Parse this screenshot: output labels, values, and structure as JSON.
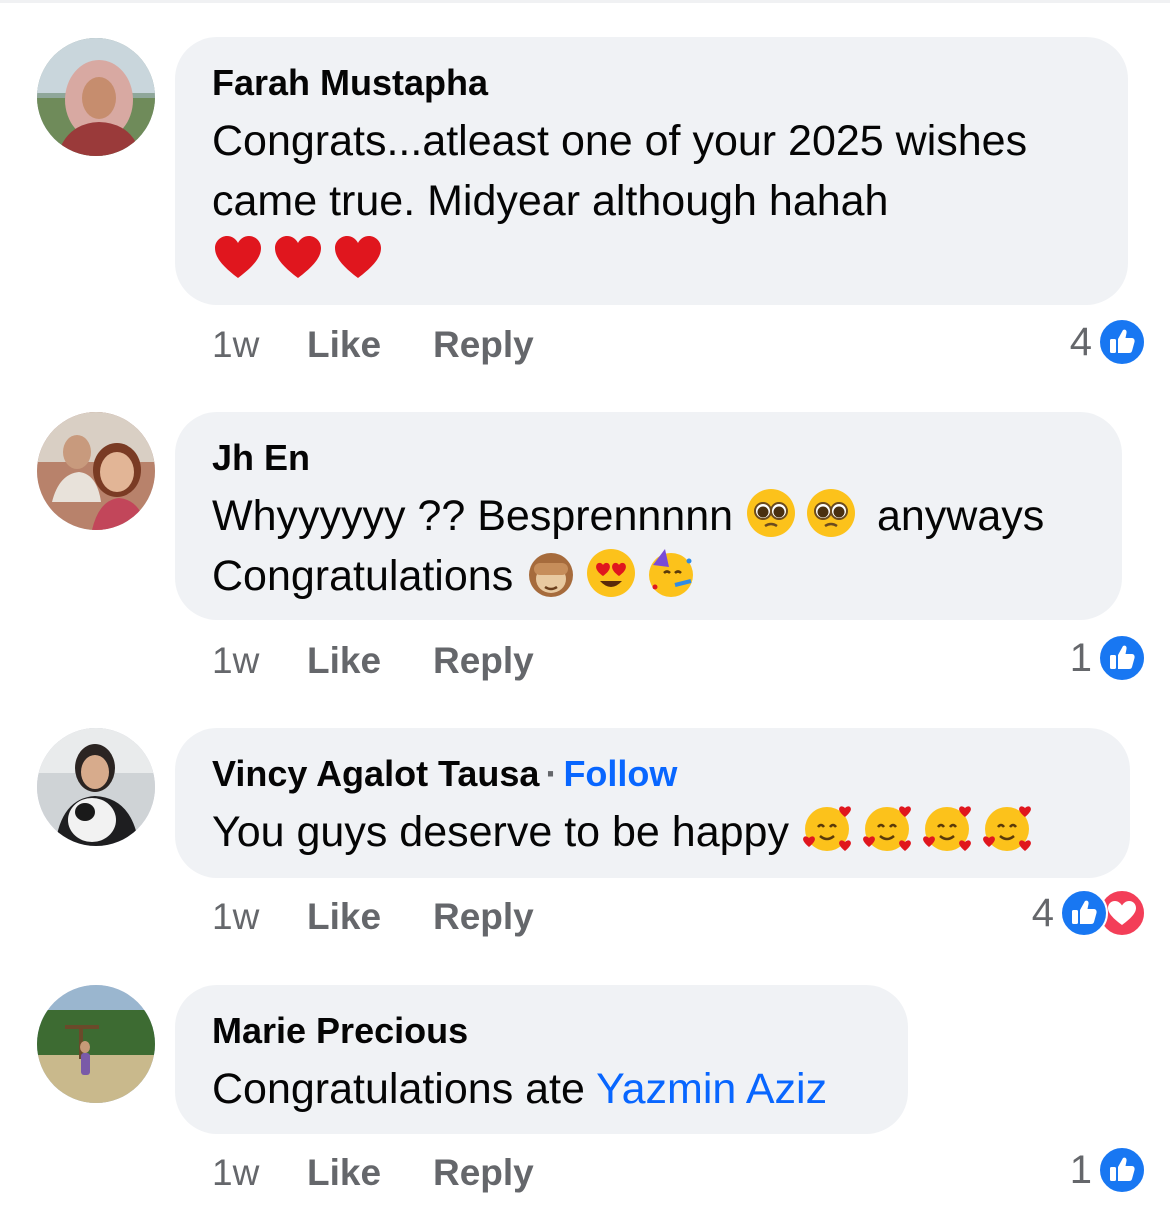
{
  "comments": [
    {
      "author": "Farah Mustapha",
      "follow": null,
      "text_line1": "Congrats...atleast one of your 2025 wishes",
      "text_line2": "came true. Midyear although hahah",
      "emojis_line3": [
        "red-heart",
        "red-heart",
        "red-heart"
      ],
      "time": "1w",
      "like": "Like",
      "reply": "Reply",
      "reaction_count": "4",
      "reactions": [
        "like"
      ]
    },
    {
      "author": "Jh En",
      "follow": null,
      "text_line1_a": "Whyyyyyy ?? Besprennnnn",
      "text_line1_emojis": [
        "pleading-face",
        "pleading-face"
      ],
      "text_line1_b": "anyways",
      "text_line2": "Congratulations",
      "text_line2_emojis": [
        "see-no-evil-monkey",
        "heart-eyes",
        "partying-face"
      ],
      "time": "1w",
      "like": "Like",
      "reply": "Reply",
      "reaction_count": "1",
      "reactions": [
        "like"
      ]
    },
    {
      "author": "Vincy Agalot Tausa",
      "separator": "·",
      "follow": "Follow",
      "text_line1": "You guys deserve to be happy",
      "text_line1_emojis": [
        "smiling-face-with-hearts",
        "smiling-face-with-hearts",
        "smiling-face-with-hearts",
        "smiling-face-with-hearts"
      ],
      "time": "1w",
      "like": "Like",
      "reply": "Reply",
      "reaction_count": "4",
      "reactions": [
        "like",
        "love"
      ]
    },
    {
      "author": "Marie Precious",
      "follow": null,
      "text_line1": "Congratulations ate",
      "mention": "Yazmin Aziz",
      "time": "1w",
      "like": "Like",
      "reply": "Reply",
      "reaction_count": "1",
      "reactions": [
        "like"
      ]
    }
  ],
  "colors": {
    "bubble": "#f0f2f5",
    "link": "#0866ff",
    "meta": "#65676b",
    "like_reaction": "#1877f2",
    "love_reaction": "#f33e58"
  }
}
